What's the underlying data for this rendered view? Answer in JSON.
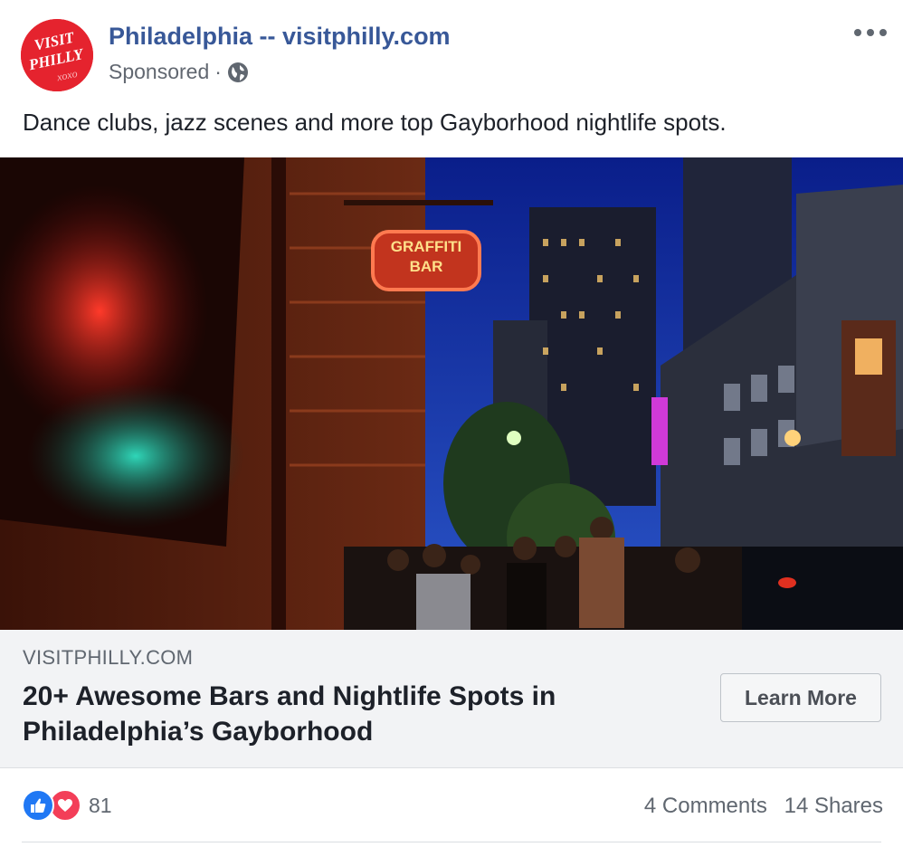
{
  "post": {
    "page_name": "Philadelphia -- visitphilly.com",
    "sponsored_label": "Sponsored",
    "separator": "·",
    "privacy_icon": "globe-icon",
    "more_icon": "ellipsis-icon",
    "text": "Dance clubs, jazz scenes and more top Gayborhood nightlife spots.",
    "avatar": {
      "logo_text_1": "VISIT",
      "logo_text_2": "PHILLY",
      "logo_text_3": "xoxo",
      "color": "#e5232e"
    }
  },
  "photo": {
    "sign_line_1": "GRAFFITI",
    "sign_line_2": "BAR"
  },
  "link_preview": {
    "domain": "VISITPHILLY.COM",
    "headline": "20+ Awesome Bars and Nightlife Spots in Philadelphia’s Gayborhood",
    "cta_label": "Learn More"
  },
  "engagement": {
    "reactions": [
      "like-icon",
      "love-icon"
    ],
    "reaction_count": "81",
    "comments": "4 Comments",
    "shares": "14 Shares"
  },
  "colors": {
    "link_blue": "#385898",
    "like_blue": "#2078f4",
    "love_red": "#f33e58",
    "preview_bg": "#f2f3f5"
  }
}
